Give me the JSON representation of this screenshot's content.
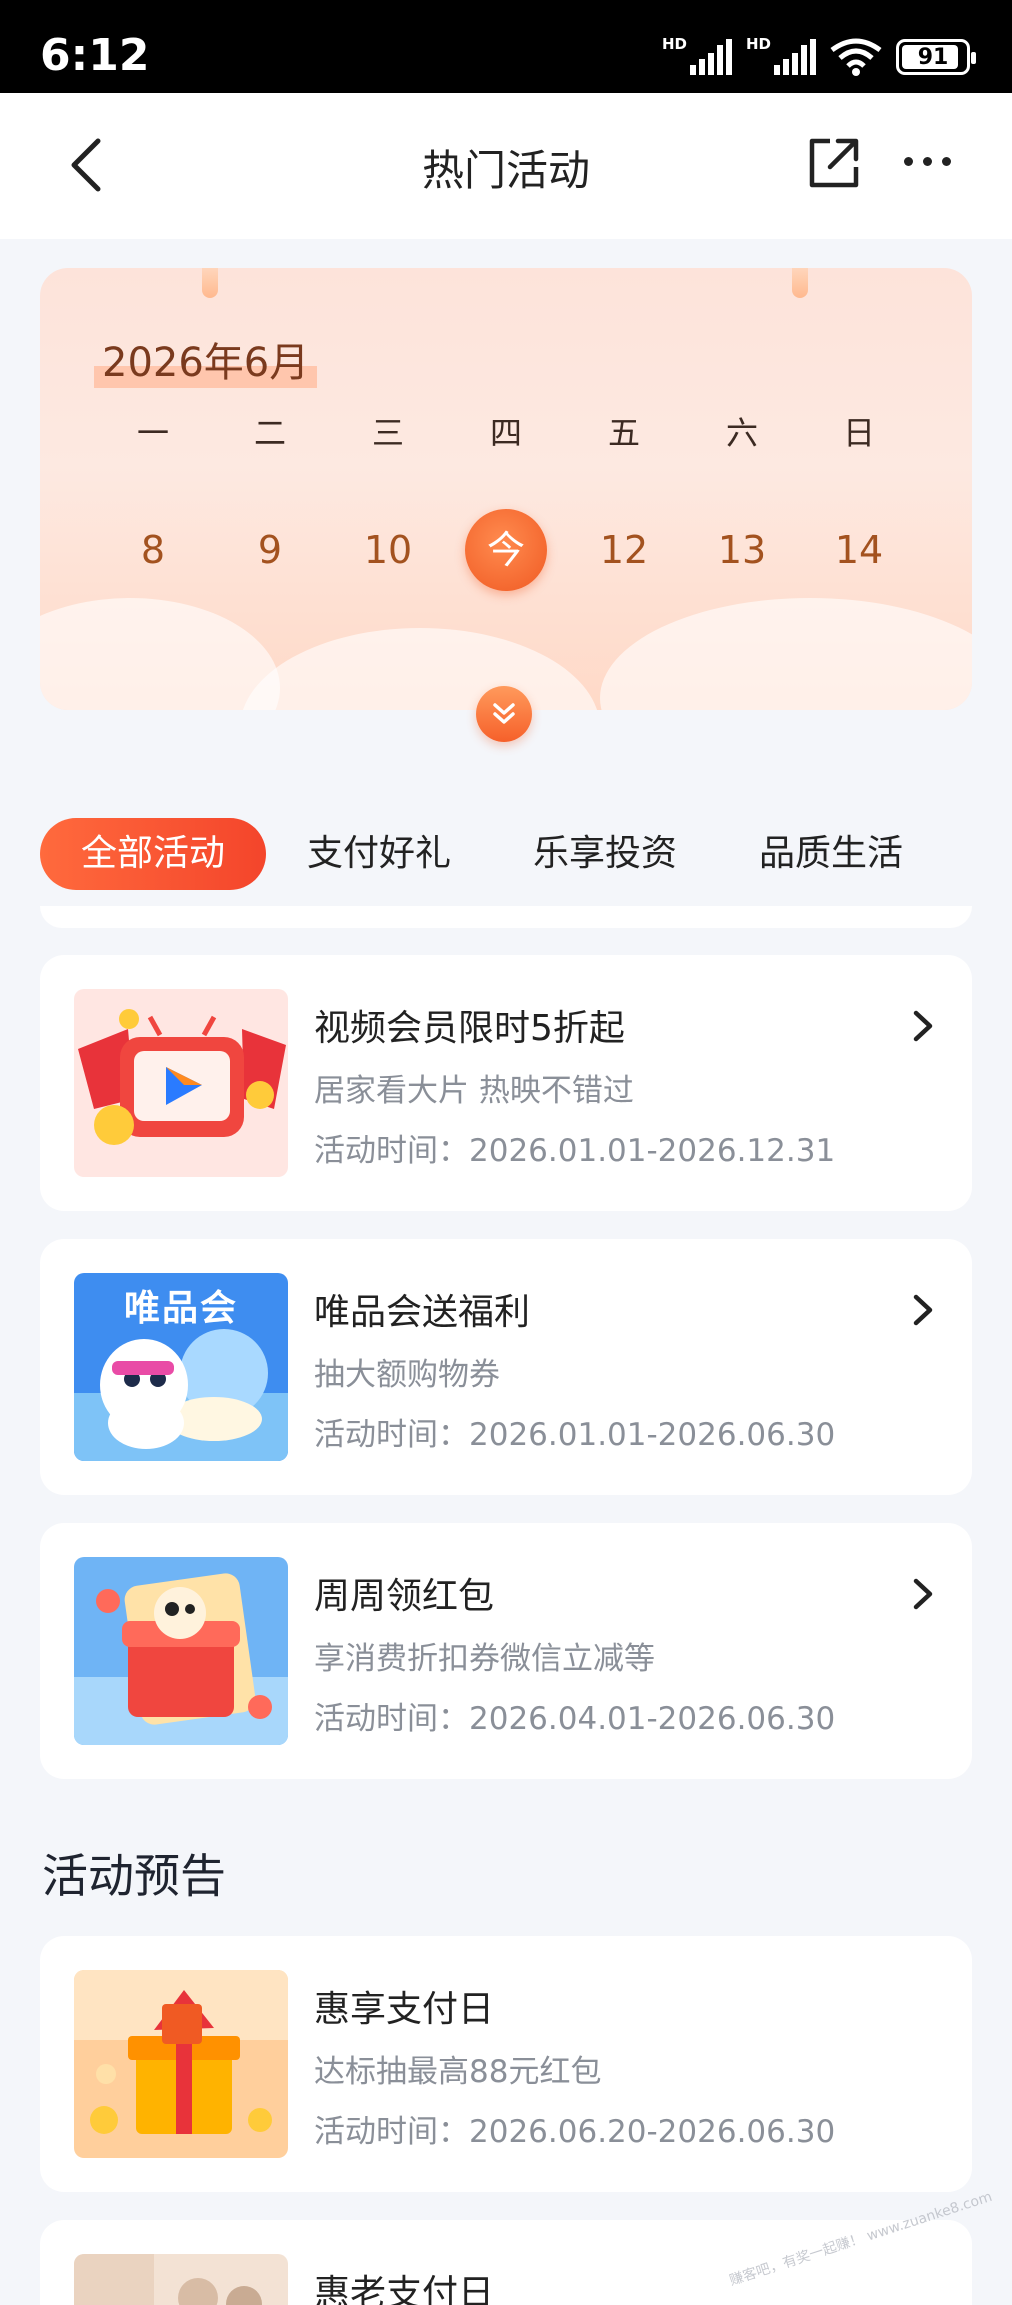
{
  "status_bar": {
    "time": "6:12",
    "signal_label": "HD",
    "battery": "91"
  },
  "nav": {
    "title": "热门活动",
    "back_icon": "chevron-left-icon",
    "share_icon": "share-icon",
    "more_icon": "more-dots-icon"
  },
  "calendar": {
    "month": "2026年6月",
    "weekdays": [
      "一",
      "二",
      "三",
      "四",
      "五",
      "六",
      "日"
    ],
    "days": [
      "8",
      "9",
      "10",
      "今",
      "12",
      "13",
      "14"
    ],
    "today_index": 3,
    "accent": "#f05a23"
  },
  "tabs": [
    "全部活动",
    "支付好礼",
    "乐享投资",
    "品质生活"
  ],
  "activities": [
    {
      "title": "视频会员限时5折起",
      "subtitle": "居家看大片 热映不错过",
      "time": "活动时间：2026.01.01-2026.12.31"
    },
    {
      "title": "唯品会送福利",
      "subtitle": "抽大额购物券",
      "time": "活动时间：2026.01.01-2026.06.30",
      "thumb_text": "唯品会"
    },
    {
      "title": "周周领红包",
      "subtitle": "享消费折扣券微信立减等",
      "time": "活动时间：2026.04.01-2026.06.30"
    }
  ],
  "preview_section": {
    "title": "活动预告"
  },
  "previews": [
    {
      "title": "惠享支付日",
      "subtitle": "达标抽最高88元红包",
      "time": "活动时间：2026.06.20-2026.06.30"
    },
    {
      "title": "惠老支付日"
    }
  ],
  "watermark": "赚客吧，有奖一起赚！ www.zuanke8.com",
  "colors": {
    "primary": "#f4452b",
    "text": "#222222",
    "muted": "#8a8f98",
    "background": "#f4f6fa"
  }
}
